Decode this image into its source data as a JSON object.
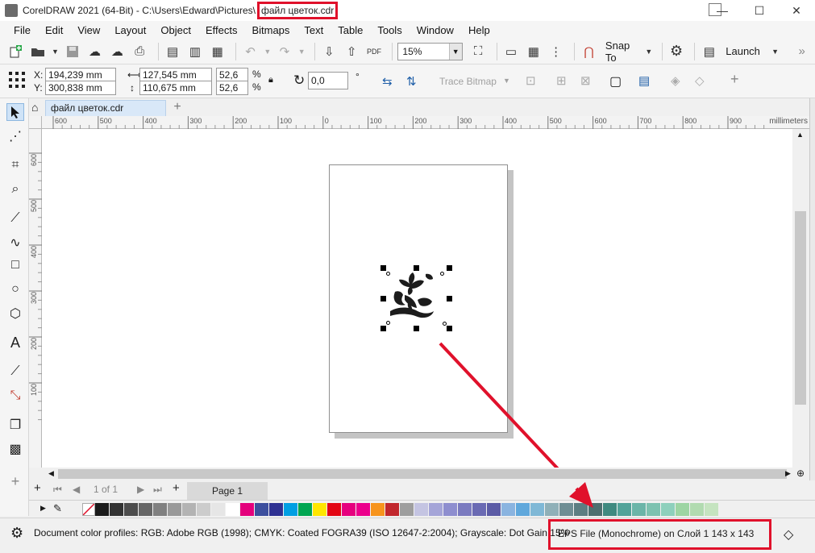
{
  "window": {
    "title_prefix": "CorelDRAW 2021 (64-Bit) - C:\\Users\\Edward\\Pictures\\",
    "title_file": "файл цветок.cdr",
    "minimize": "—",
    "maximize": "☐",
    "close": "✕"
  },
  "menu": [
    "File",
    "Edit",
    "View",
    "Layout",
    "Object",
    "Effects",
    "Bitmaps",
    "Text",
    "Table",
    "Tools",
    "Window",
    "Help"
  ],
  "toolbar": {
    "zoom_value": "15%",
    "snap_to_label": "Snap To",
    "launch_label": "Launch",
    "more_label": "»"
  },
  "properties": {
    "x_label": "X:",
    "x_value": "194,239 mm",
    "y_label": "Y:",
    "y_value": "300,838 mm",
    "width_value": "127,545 mm",
    "height_value": "110,675 mm",
    "scale_x": "52,6",
    "scale_y": "52,6",
    "percent": "%",
    "rotation": "0,0",
    "degree": "°",
    "trace_bitmap_label": "Trace Bitmap"
  },
  "tabs": {
    "document_tab": "файл цветок.cdr",
    "add_tab": "+"
  },
  "rulers": {
    "units": "millimeters",
    "h_ticks": [
      "600",
      "500",
      "400",
      "300",
      "200",
      "100",
      "0",
      "100",
      "200",
      "300",
      "400",
      "500",
      "600",
      "700",
      "800",
      "900"
    ],
    "v_ticks": [
      "600",
      "500",
      "400",
      "300",
      "200",
      "100"
    ]
  },
  "page_nav": {
    "page_counter": "1 of 1",
    "page_tab": "Page 1"
  },
  "palette_colors": [
    "#1a1a1a",
    "#333333",
    "#4d4d4d",
    "#666666",
    "#808080",
    "#999999",
    "#b3b3b3",
    "#cccccc",
    "#e6e6e6",
    "#ffffff",
    "#e4007c",
    "#3d4f9e",
    "#2e3192",
    "#009fe3",
    "#00a651",
    "#ffe600",
    "#e30613",
    "#e6007e",
    "#ec008c",
    "#f7941d",
    "#c1272d",
    "#9e9e9e",
    "#c4c4e2",
    "#a5a5d8",
    "#8e8ecf",
    "#7b7bc0",
    "#6a6ab3",
    "#5c5ca6",
    "#8ab4e0",
    "#60a8dc",
    "#7fb8d6",
    "#8fb0b8",
    "#6e8e94",
    "#5c7e82",
    "#4d6f6f",
    "#3f8a80",
    "#52a399",
    "#6bb5a8",
    "#7dc2b0",
    "#8ed0bc",
    "#9dd5a3",
    "#b1dbb0",
    "#c5e4c0"
  ],
  "status": {
    "color_profiles": "Document color profiles: RGB: Adobe RGB (1998); CMYK: Coated FOGRA39 (ISO 12647-2:2004); Grayscale: Dot Gain 15%",
    "object_info": "EPS File (Monochrome) on Слой 1 143 x 143 dpi"
  }
}
